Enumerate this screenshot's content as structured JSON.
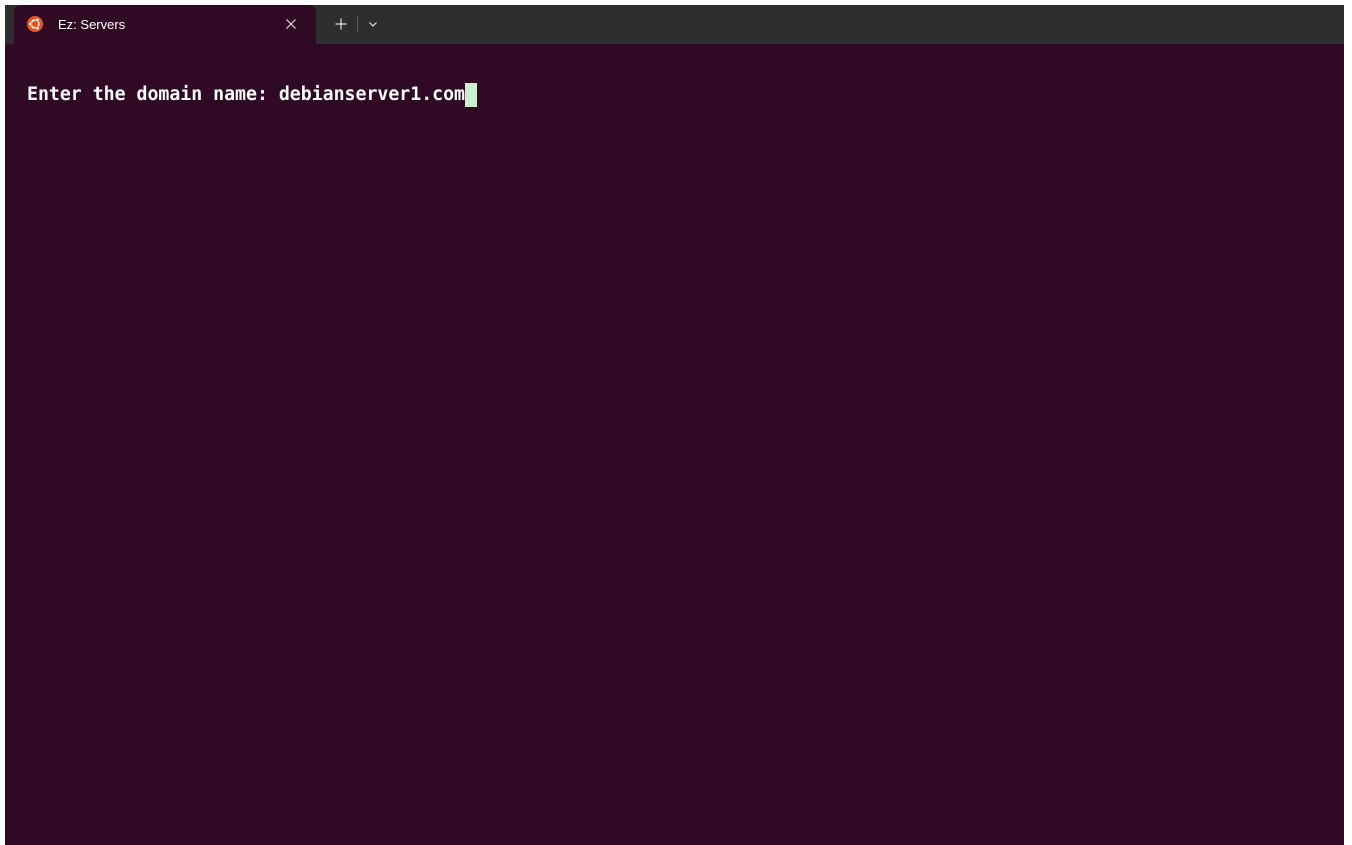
{
  "tab": {
    "title": "Ez: Servers",
    "icon": "ubuntu-logo-icon",
    "close_icon": "close-icon"
  },
  "tabbar": {
    "new_tab_icon": "plus-icon",
    "dropdown_icon": "chevron-down-icon"
  },
  "terminal": {
    "prompt": "Enter the domain name: ",
    "input": "debianserver1.com"
  },
  "colors": {
    "background": "#300a24",
    "tabbar": "#2e2e2e",
    "text": "#ffffff",
    "cursor": "#c9f1cd",
    "icon_accent": "#e95420"
  }
}
